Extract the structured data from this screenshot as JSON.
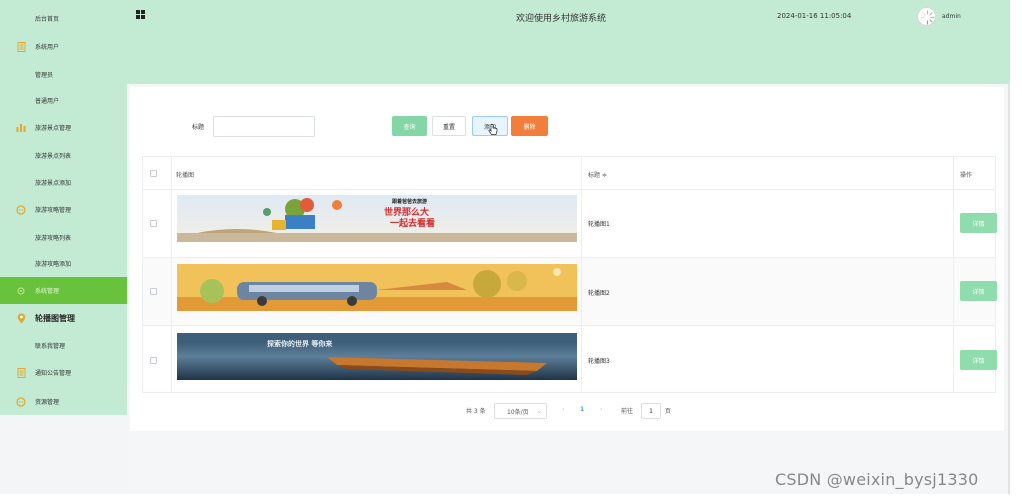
{
  "colors": {
    "accent_green": "#69c23c",
    "header_bg": "#c3ebd4",
    "query_btn": "#84d6a7",
    "delete_btn": "#f27e3b"
  },
  "header": {
    "title": "欢迎使用乡村旅游系统",
    "datetime": "2024-01-16 11:05:04",
    "username": "admin",
    "menu_icon": "grid-icon"
  },
  "sidebar": {
    "items": [
      {
        "label": "后台首页",
        "icon": ""
      },
      {
        "label": "系统用户",
        "icon": "document-icon"
      },
      {
        "label": "管理员",
        "icon": ""
      },
      {
        "label": "普通用户",
        "icon": ""
      },
      {
        "label": "旅游景点管理",
        "icon": "bar-chart-icon"
      },
      {
        "label": "旅游景点列表",
        "icon": ""
      },
      {
        "label": "旅游景点添加",
        "icon": ""
      },
      {
        "label": "旅游攻略管理",
        "icon": "chat-icon"
      },
      {
        "label": "旅游攻略列表",
        "icon": ""
      },
      {
        "label": "旅游攻略添加",
        "icon": ""
      },
      {
        "label": "系统管理",
        "icon": "settings-icon"
      },
      {
        "label": "轮播图管理",
        "icon": "location-icon"
      },
      {
        "label": "联系我管理",
        "icon": ""
      },
      {
        "label": "通知公告管理",
        "icon": "document-icon"
      },
      {
        "label": "资源管理",
        "icon": "chat-icon"
      }
    ]
  },
  "search": {
    "label": "标题",
    "value": "",
    "placeholder": ""
  },
  "toolbar": {
    "query": "查询",
    "reset": "重置",
    "add": "添加",
    "delete": "删除"
  },
  "table": {
    "headers": [
      "轮播图",
      "标题 ≑",
      "操作"
    ],
    "rows": [
      {
        "title": "轮播图1",
        "banner_text": [
          "跟着爸爸去旅游",
          "世界那么大",
          "一起去看看"
        ],
        "action": "详情"
      },
      {
        "title": "轮播图2",
        "action": "详情"
      },
      {
        "title": "轮播图3",
        "banner_text": [
          "探索你的世界 等你来"
        ],
        "action": "详情"
      }
    ]
  },
  "pagination": {
    "total": "共 3 条",
    "page_size": "10条/页",
    "current_page": "1",
    "goto_label": "前往",
    "goto_value": "1",
    "page_suffix": "页"
  },
  "watermark": "CSDN @weixin_bysj1330"
}
